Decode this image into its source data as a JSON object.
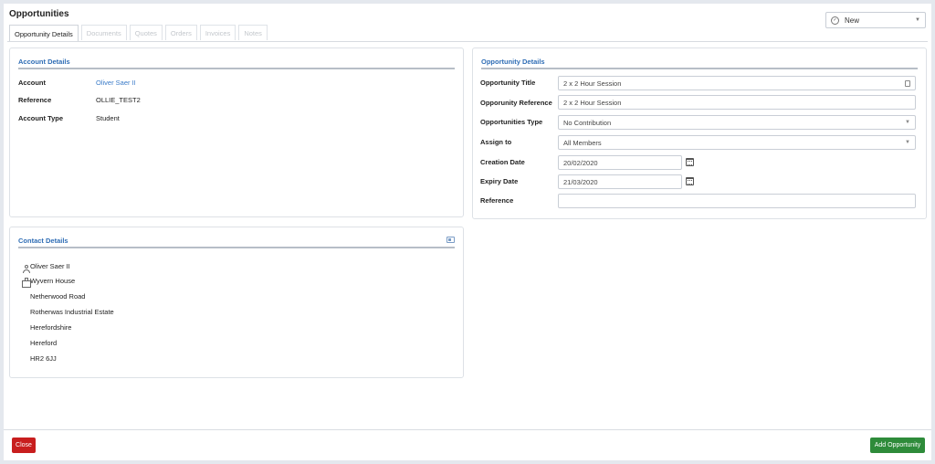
{
  "page": {
    "title": "Opportunities"
  },
  "status": {
    "value": "New"
  },
  "tabs": [
    "Opportunity Details",
    "Documents",
    "Quotes",
    "Orders",
    "Invoices",
    "Notes"
  ],
  "account": {
    "header": "Account Details",
    "rows": [
      {
        "label": "Account",
        "value": "Oliver Saer II"
      },
      {
        "label": "Reference",
        "value": "OLLIE_TEST2"
      },
      {
        "label": "Account Type",
        "value": "Student"
      }
    ]
  },
  "contact": {
    "header": "Contact Details",
    "name": "Oliver Saer II",
    "address": [
      "Wyvern House",
      "Netherwood Road",
      "Rotherwas Industrial Estate",
      "Herefordshire",
      "Hereford",
      "HR2 6JJ"
    ]
  },
  "opportunity": {
    "header": "Opportunity Details",
    "title_label": "Opportunity Title",
    "title_value": "2 x 2 Hour Session",
    "reference_label": "Opporunity Reference",
    "reference_value": "2 x 2 Hour Session",
    "type_label": "Opportunities Type",
    "type_value": "No Contribution",
    "assign_label": "Assign to",
    "assign_value": "All Members",
    "creation_label": "Creation Date",
    "creation_value": "20/02/2020",
    "expiry_label": "Expiry Date",
    "expiry_value": "21/03/2020",
    "ref2_label": "Reference",
    "ref2_value": ""
  },
  "footer": {
    "close_label": "Close",
    "add_label": "Add Opportunity"
  },
  "colors": {
    "link": "#3a7bc8",
    "close": "#c81e1e",
    "add": "#2e8b3a",
    "header": "#2f6db5"
  },
  "icons": [
    "check-circle-icon",
    "chevron-down-icon",
    "document-icon",
    "calendar-icon",
    "person-icon",
    "building-icon",
    "contact-card-icon"
  ]
}
